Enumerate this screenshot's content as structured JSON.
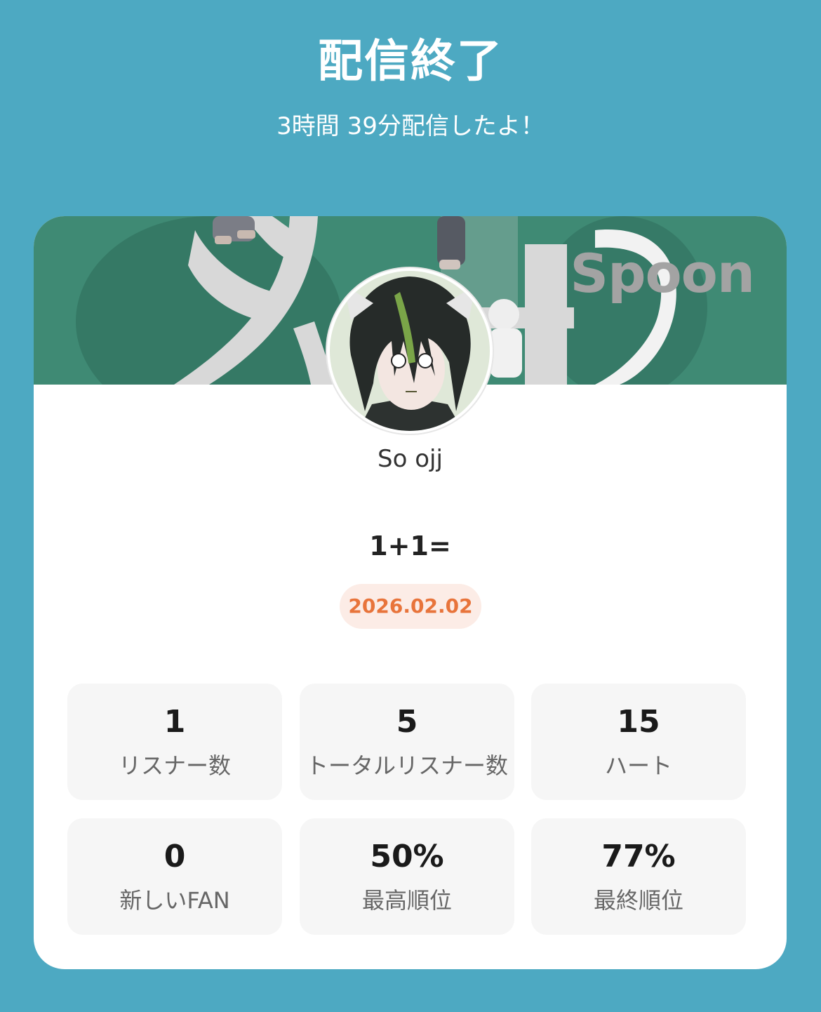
{
  "header": {
    "title": "配信終了",
    "subtitle": "3時間 39分配信したよ！"
  },
  "card": {
    "brand": "Spoon",
    "user_name": "So ojj",
    "stream_title": "1+1=",
    "date": "2026.02.02",
    "stats": [
      {
        "value": "1",
        "label": "リスナー数"
      },
      {
        "value": "5",
        "label": "トータルリスナー数"
      },
      {
        "value": "15",
        "label": "ハート"
      },
      {
        "value": "0",
        "label": "新しいFAN"
      },
      {
        "value": "50%",
        "label": "最高順位"
      },
      {
        "value": "77%",
        "label": "最終順位"
      }
    ]
  },
  "colors": {
    "background": "#4da9c2",
    "banner": "#3f8a74",
    "date_text": "#e8743b",
    "date_badge": "#fcece6",
    "tile": "#f6f6f6"
  },
  "icons": [
    "avatar-image",
    "cover-image"
  ]
}
